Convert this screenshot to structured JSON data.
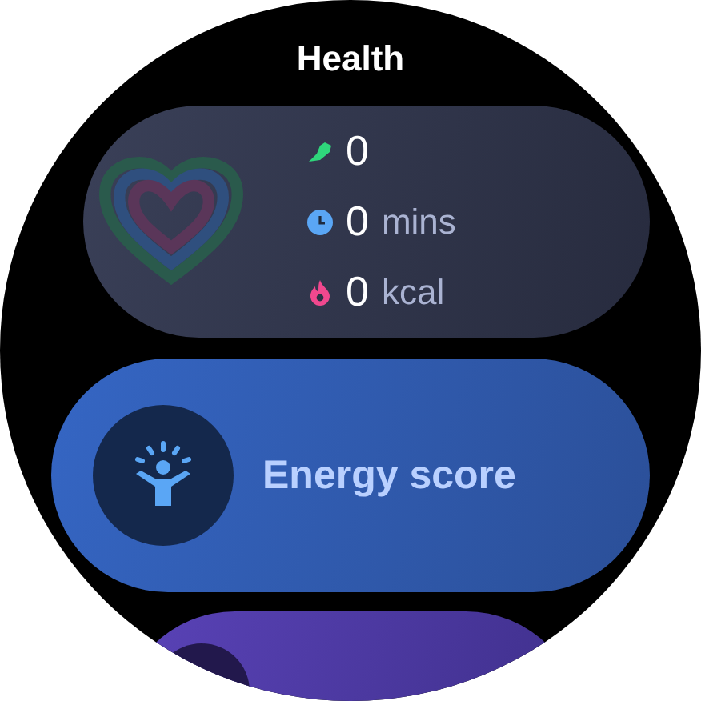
{
  "screen": {
    "title": "Health"
  },
  "activity_card": {
    "stats": [
      {
        "kind": "steps",
        "value": "0"
      },
      {
        "kind": "time",
        "value": "0",
        "unit": "mins"
      },
      {
        "kind": "calories",
        "value": "0",
        "unit": "kcal"
      }
    ]
  },
  "tiles": [
    {
      "kind": "energy",
      "label": "Energy score"
    },
    {
      "kind": "sleep"
    }
  ]
}
